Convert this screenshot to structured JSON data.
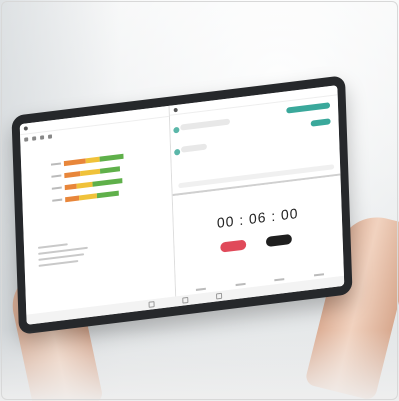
{
  "scene": {
    "description_ignored": "",
    "timer": {
      "display": "00 : 06 : 00"
    },
    "chart": {
      "rows": [
        {
          "segments": [
            {
              "w": 22,
              "c": "#e8863a"
            },
            {
              "w": 14,
              "c": "#f0c23a"
            },
            {
              "w": 24,
              "c": "#5fb04a"
            }
          ]
        },
        {
          "segments": [
            {
              "w": 16,
              "c": "#e8863a"
            },
            {
              "w": 20,
              "c": "#f0c23a"
            },
            {
              "w": 20,
              "c": "#5fb04a"
            }
          ]
        },
        {
          "segments": [
            {
              "w": 12,
              "c": "#e8863a"
            },
            {
              "w": 16,
              "c": "#f0c23a"
            },
            {
              "w": 30,
              "c": "#5fb04a"
            }
          ]
        },
        {
          "segments": [
            {
              "w": 14,
              "c": "#e8863a"
            },
            {
              "w": 18,
              "c": "#f0c23a"
            },
            {
              "w": 22,
              "c": "#5fb04a"
            }
          ]
        }
      ]
    },
    "colors": {
      "accent_teal": "#3aa89b",
      "start_red": "#e04a5a",
      "cancel_dark": "#1f1f1f"
    }
  }
}
